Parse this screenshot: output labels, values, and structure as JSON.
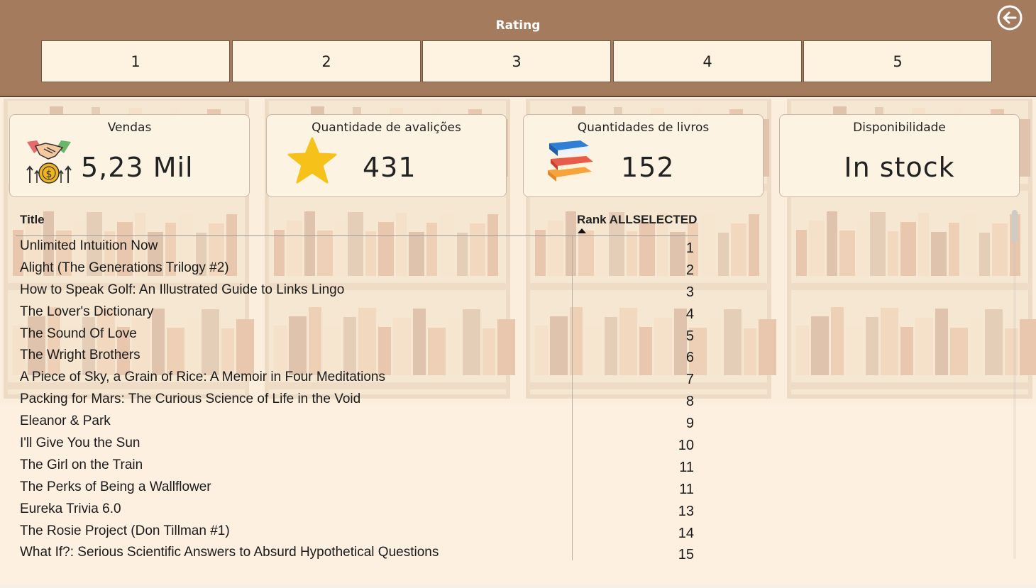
{
  "header": {
    "title": "Rating",
    "slicer_options": [
      "1",
      "2",
      "3",
      "4",
      "5"
    ]
  },
  "cards": [
    {
      "title": "Vendas",
      "value": "5,23 Mil",
      "icon": "handshake-money-icon"
    },
    {
      "title": "Quantidade de avalições",
      "value": "431",
      "icon": "star-icon"
    },
    {
      "title": "Quantidades de livros",
      "value": "152",
      "icon": "books-stack-icon"
    },
    {
      "title": "Disponibilidade",
      "value": "In stock",
      "icon": ""
    }
  ],
  "table": {
    "columns": [
      "Title",
      "Rank ALLSELECTED"
    ],
    "rows": [
      {
        "title": "Unlimited Intuition Now",
        "rank": "1"
      },
      {
        "title": "Alight (The Generations Trilogy #2)",
        "rank": "2"
      },
      {
        "title": "How to Speak Golf: An Illustrated Guide to Links Lingo",
        "rank": "3"
      },
      {
        "title": "The Lover's Dictionary",
        "rank": "4"
      },
      {
        "title": "The Sound Of Love",
        "rank": "5"
      },
      {
        "title": "The Wright Brothers",
        "rank": "6"
      },
      {
        "title": "A Piece of Sky, a Grain of Rice: A Memoir in Four Meditations",
        "rank": "7"
      },
      {
        "title": "Packing for Mars: The Curious Science of Life in the Void",
        "rank": "8"
      },
      {
        "title": "Eleanor & Park",
        "rank": "9"
      },
      {
        "title": "I'll Give You the Sun",
        "rank": "10"
      },
      {
        "title": "The Girl on the Train",
        "rank": "11"
      },
      {
        "title": "The Perks of Being a Wallflower",
        "rank": "11"
      },
      {
        "title": "Eureka Trivia 6.0",
        "rank": "13"
      },
      {
        "title": "The Rosie Project (Don Tillman #1)",
        "rank": "14"
      },
      {
        "title": "What If?: Serious Scientific Answers to Absurd Hypothetical Questions",
        "rank": "15"
      }
    ]
  },
  "colors": {
    "header_bg": "#a57b5e",
    "card_bg": "#fdf3e2",
    "page_bg": "#fdf3e4"
  }
}
